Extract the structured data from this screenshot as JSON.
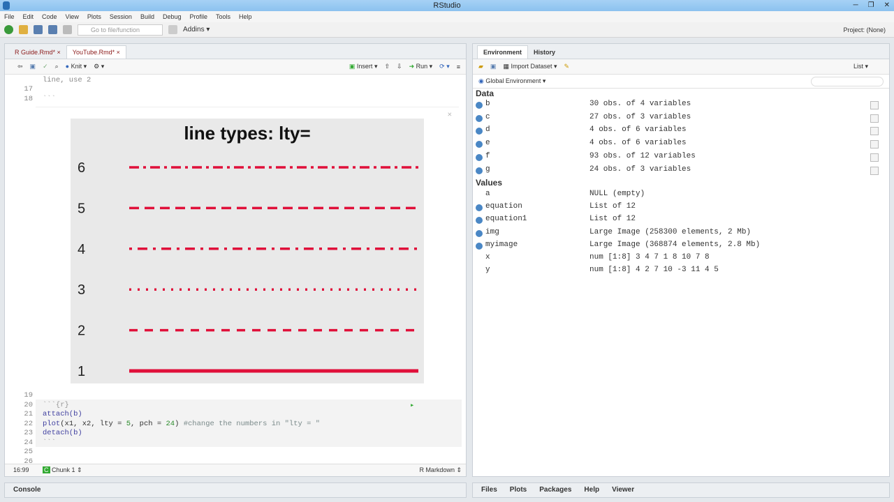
{
  "app": {
    "title": "RStudio"
  },
  "menu": [
    "File",
    "Edit",
    "Code",
    "View",
    "Plots",
    "Session",
    "Build",
    "Debug",
    "Profile",
    "Tools",
    "Help"
  ],
  "toolbar": {
    "goto_placeholder": "Go to file/function",
    "addins": "Addins",
    "project": "Project: (None)"
  },
  "editor": {
    "tabs": [
      "R Guide.Rmd*",
      "YouTube.Rmd*"
    ],
    "knit": "Knit",
    "insert": "Insert",
    "run": "Run",
    "lines": [
      {
        "n": "",
        "t": "line, use 2"
      },
      {
        "n": "17",
        "t": ""
      },
      {
        "n": "18",
        "t": "```"
      },
      {
        "n": "19",
        "t": ""
      },
      {
        "n": "20",
        "t": "```{r}"
      },
      {
        "n": "21",
        "t": "attach(b)"
      },
      {
        "n": "22",
        "t": "plot(x1, x2, lty = 5, pch = 24) #change the numbers in \"lty = \""
      },
      {
        "n": "23",
        "t": "detach(b)"
      },
      {
        "n": "24",
        "t": "```"
      },
      {
        "n": "25",
        "t": ""
      },
      {
        "n": "26",
        "t": ""
      }
    ],
    "status": {
      "position": "16:99",
      "chunk": "Chunk 1",
      "mode": "R Markdown"
    }
  },
  "plot_image": {
    "title": "line types: lty=",
    "labels": [
      "6",
      "5",
      "4",
      "3",
      "2",
      "1"
    ],
    "color": "#e0103a"
  },
  "console": {
    "label": "Console"
  },
  "environment": {
    "tabs": [
      "Environment",
      "History"
    ],
    "import": "Import Dataset",
    "view": "List",
    "scope": "Global Environment",
    "data_header": "Data",
    "data": [
      {
        "name": "b",
        "value": "30 obs. of 4 variables"
      },
      {
        "name": "c",
        "value": "27 obs. of 3 variables"
      },
      {
        "name": "d",
        "value": "4 obs. of 6 variables"
      },
      {
        "name": "e",
        "value": "4 obs. of 6 variables"
      },
      {
        "name": "f",
        "value": "93 obs. of 12 variables"
      },
      {
        "name": "g",
        "value": "24 obs. of 3 variables"
      }
    ],
    "values_header": "Values",
    "values": [
      {
        "name": "a",
        "value": "NULL (empty)"
      },
      {
        "name": "equation",
        "value": "List of 12"
      },
      {
        "name": "equation1",
        "value": "List of 12"
      },
      {
        "name": "img",
        "value": "Large Image (258300 elements, 2 Mb)"
      },
      {
        "name": "myimage",
        "value": "Large Image (368874 elements, 2.8 Mb)"
      },
      {
        "name": "x",
        "value": "num [1:8] 3 4 7 1 8 10 7 8"
      },
      {
        "name": "y",
        "value": "num [1:8] 4 2 7 10 -3 11 4 5"
      }
    ]
  },
  "files_tabs": [
    "Files",
    "Plots",
    "Packages",
    "Help",
    "Viewer"
  ]
}
